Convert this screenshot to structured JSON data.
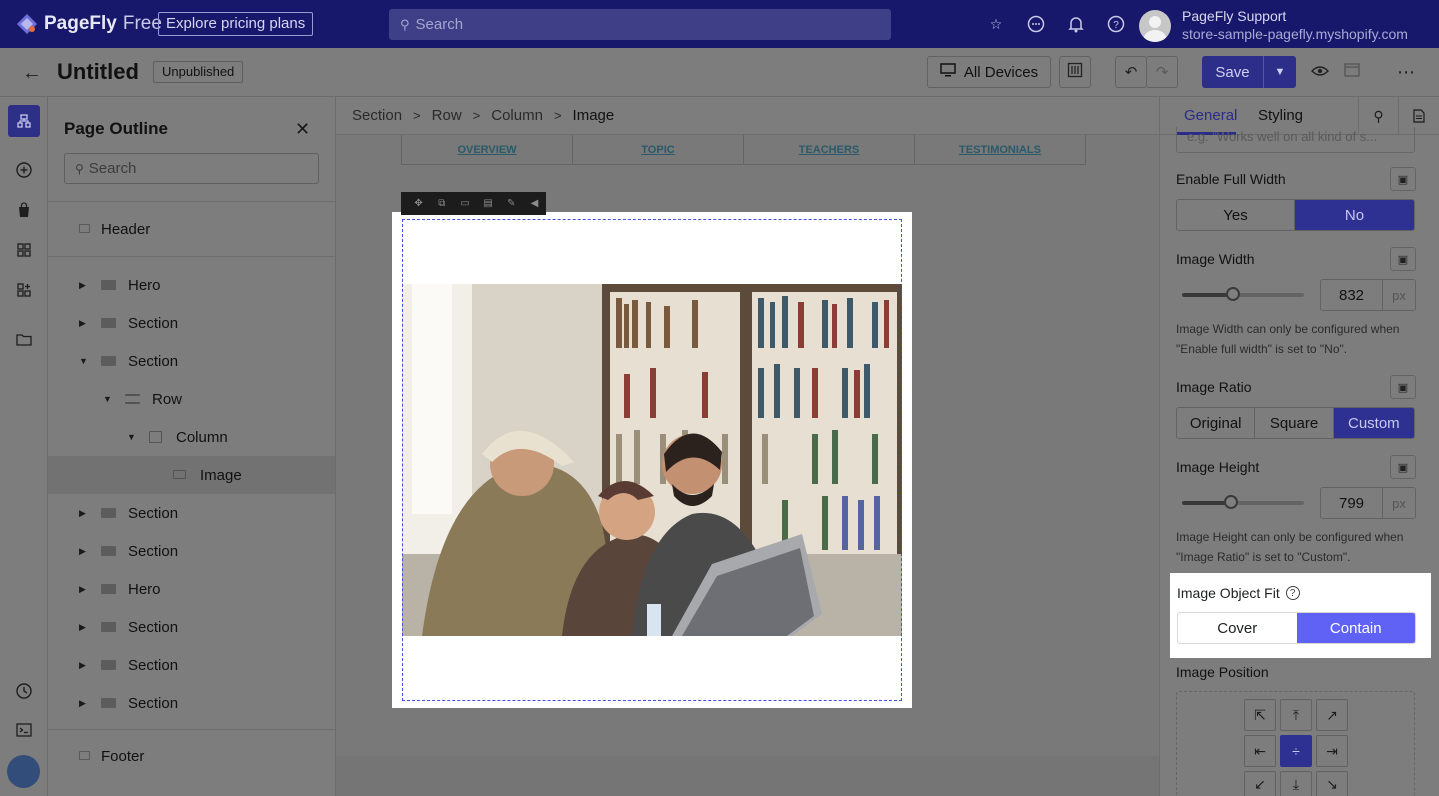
{
  "topbar": {
    "brand": "PageFly",
    "plan": "Free",
    "pricing_label": "Explore pricing plans",
    "search_placeholder": "Search",
    "user_name": "PageFly Support",
    "user_store": "store-sample-pagefly.myshopify.com"
  },
  "toolbar": {
    "title": "Untitled",
    "status": "Unpublished",
    "devices_label": "All Devices",
    "save_label": "Save"
  },
  "outline": {
    "title": "Page Outline",
    "search_placeholder": "Search",
    "header_label": "Header",
    "footer_label": "Footer",
    "items": [
      {
        "label": "Hero"
      },
      {
        "label": "Section"
      },
      {
        "label": "Section"
      },
      {
        "label": "Row"
      },
      {
        "label": "Column"
      },
      {
        "label": "Image"
      },
      {
        "label": "Section"
      },
      {
        "label": "Section"
      },
      {
        "label": "Hero"
      },
      {
        "label": "Section"
      },
      {
        "label": "Section"
      },
      {
        "label": "Section"
      }
    ]
  },
  "canvas": {
    "breadcrumb": [
      "Section",
      "Row",
      "Column",
      "Image"
    ],
    "nav_tabs": [
      "OVERVIEW",
      "TOPIC",
      "TEACHERS",
      "TESTIMONIALS"
    ]
  },
  "settings": {
    "tab_general": "General",
    "tab_styling": "Styling",
    "alt_placeholder": "e.g. \"Works well on all kind of s...",
    "full_width": {
      "label": "Enable Full Width",
      "options": [
        "Yes",
        "No"
      ],
      "selected": "No"
    },
    "image_width": {
      "label": "Image Width",
      "value": "832",
      "unit": "px",
      "slider_pct": 0.42,
      "hint": "Image Width can only be configured when \"Enable full width\" is set to \"No\"."
    },
    "image_ratio": {
      "label": "Image Ratio",
      "options": [
        "Original",
        "Square",
        "Custom"
      ],
      "selected": "Custom"
    },
    "image_height": {
      "label": "Image Height",
      "value": "799",
      "unit": "px",
      "slider_pct": 0.4,
      "hint": "Image Height can only be configured when \"Image Ratio\" is set to \"Custom\"."
    },
    "object_fit": {
      "label": "Image Object Fit",
      "options": [
        "Cover",
        "Contain"
      ],
      "selected": "Contain"
    },
    "image_position": {
      "label": "Image Position",
      "selected": "center"
    }
  },
  "colors": {
    "brand_bar": "#17186b",
    "accent": "#5f62f5",
    "selection_dash": "#3f51d8"
  }
}
